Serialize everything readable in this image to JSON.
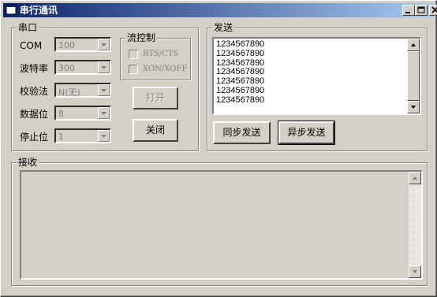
{
  "window": {
    "title": "串行通讯",
    "title_bar_gradient": [
      "#0a246a",
      "#a6caf0"
    ]
  },
  "port_group": {
    "title": "串口",
    "rows": [
      {
        "label": "COM",
        "value": "100"
      },
      {
        "label": "波特率",
        "value": "300"
      },
      {
        "label": "校验法",
        "value": "N(无)"
      },
      {
        "label": "数据位",
        "value": "8"
      },
      {
        "label": "停止位",
        "value": "1"
      }
    ],
    "flow": {
      "title": "流控制",
      "rts": "RTS/CTS",
      "xon": "XON/XOFF"
    },
    "open_button": "打开",
    "close_button": "关闭"
  },
  "send_group": {
    "title": "发送",
    "lines": [
      "1234567890",
      "1234567890",
      "1234567890",
      "1234567890",
      "1234567890",
      "1234567890",
      "1234567890"
    ],
    "sync_button": "同步发送",
    "async_button": "异步发送"
  },
  "receive_group": {
    "title": "接收"
  }
}
